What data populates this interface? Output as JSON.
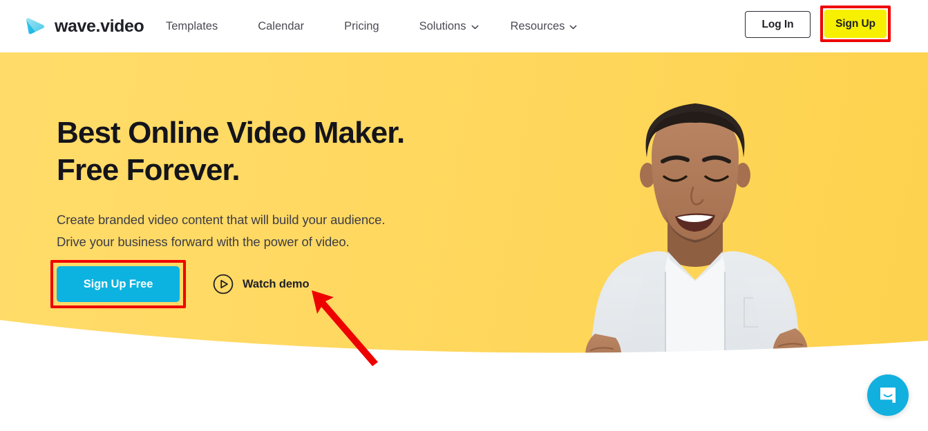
{
  "header": {
    "logo": {
      "icon": "wave-play-logo-icon",
      "text": "wave.video"
    },
    "nav": [
      {
        "label": "Templates",
        "caret": false
      },
      {
        "label": "Calendar",
        "caret": false
      },
      {
        "label": "Pricing",
        "caret": false
      },
      {
        "label": "Solutions",
        "caret": true
      },
      {
        "label": "Resources",
        "caret": true
      }
    ],
    "login_label": "Log In",
    "signup_label": "Sign Up"
  },
  "hero": {
    "headline": "Best Online Video Maker.\nFree Forever.",
    "subcopy": "Create branded video content that will build your audience.\nDrive your business forward with the power of video.",
    "cta_primary_label": "Sign Up Free",
    "watch_demo_label": "Watch demo",
    "watch_demo_icon": "play-circle-icon"
  },
  "chat": {
    "icon": "chat-bubble-smile-icon"
  },
  "annotations": {
    "highlight_color": "#ee0000",
    "arrow_color": "#ee0000",
    "targets": [
      "Sign Up",
      "Sign Up Free",
      "Watch demo"
    ]
  },
  "colors": {
    "hero_yellow": "#ffd860",
    "hero_yellow_right": "#fdd24d",
    "cta_cyan": "#0cb3e0",
    "signup_yellow": "#f7f000",
    "chat_cyan": "#12b0df",
    "text_dark": "#14141b",
    "nav_text": "#4b4b55"
  }
}
